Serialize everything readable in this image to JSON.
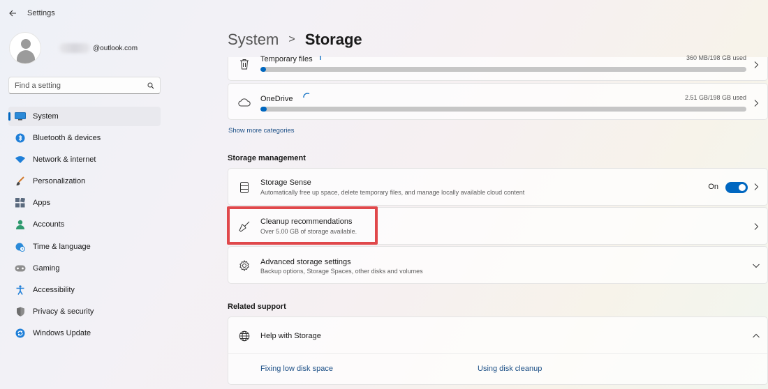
{
  "window": {
    "title": "Settings"
  },
  "profile": {
    "email": "@outlook.com"
  },
  "search": {
    "placeholder": "Find a setting"
  },
  "sidebar": {
    "items": [
      {
        "label": "System",
        "icon": "system-icon",
        "active": true
      },
      {
        "label": "Bluetooth & devices",
        "icon": "bluetooth-icon"
      },
      {
        "label": "Network & internet",
        "icon": "wifi-icon"
      },
      {
        "label": "Personalization",
        "icon": "brush-icon"
      },
      {
        "label": "Apps",
        "icon": "apps-icon"
      },
      {
        "label": "Accounts",
        "icon": "person-icon"
      },
      {
        "label": "Time & language",
        "icon": "globe-clock-icon"
      },
      {
        "label": "Gaming",
        "icon": "gamepad-icon"
      },
      {
        "label": "Accessibility",
        "icon": "accessibility-icon"
      },
      {
        "label": "Privacy & security",
        "icon": "shield-icon"
      },
      {
        "label": "Windows Update",
        "icon": "update-icon"
      }
    ]
  },
  "breadcrumb": {
    "parent": "System",
    "separator": ">",
    "current": "Storage"
  },
  "storage_categories": [
    {
      "name": "Temporary files",
      "usage": "360 MB/198 GB used",
      "fill": 0.002
    },
    {
      "name": "OneDrive",
      "usage": "2.51 GB/198 GB used",
      "fill": 0.013
    }
  ],
  "show_more": "Show more categories",
  "storage_management": {
    "title": "Storage management",
    "storage_sense": {
      "title": "Storage Sense",
      "desc": "Automatically free up space, delete temporary files, and manage locally available cloud content",
      "toggle_label": "On",
      "toggle_state": true
    },
    "cleanup": {
      "title": "Cleanup recommendations",
      "desc": "Over 5.00 GB of storage available."
    },
    "advanced": {
      "title": "Advanced storage settings",
      "desc": "Backup options, Storage Spaces, other disks and volumes"
    }
  },
  "related_support": {
    "title": "Related support",
    "help": {
      "title": "Help with Storage",
      "links": [
        "Fixing low disk space",
        "Using disk cleanup"
      ]
    }
  },
  "colors": {
    "accent": "#0067c0",
    "highlight": "#e0484b"
  }
}
